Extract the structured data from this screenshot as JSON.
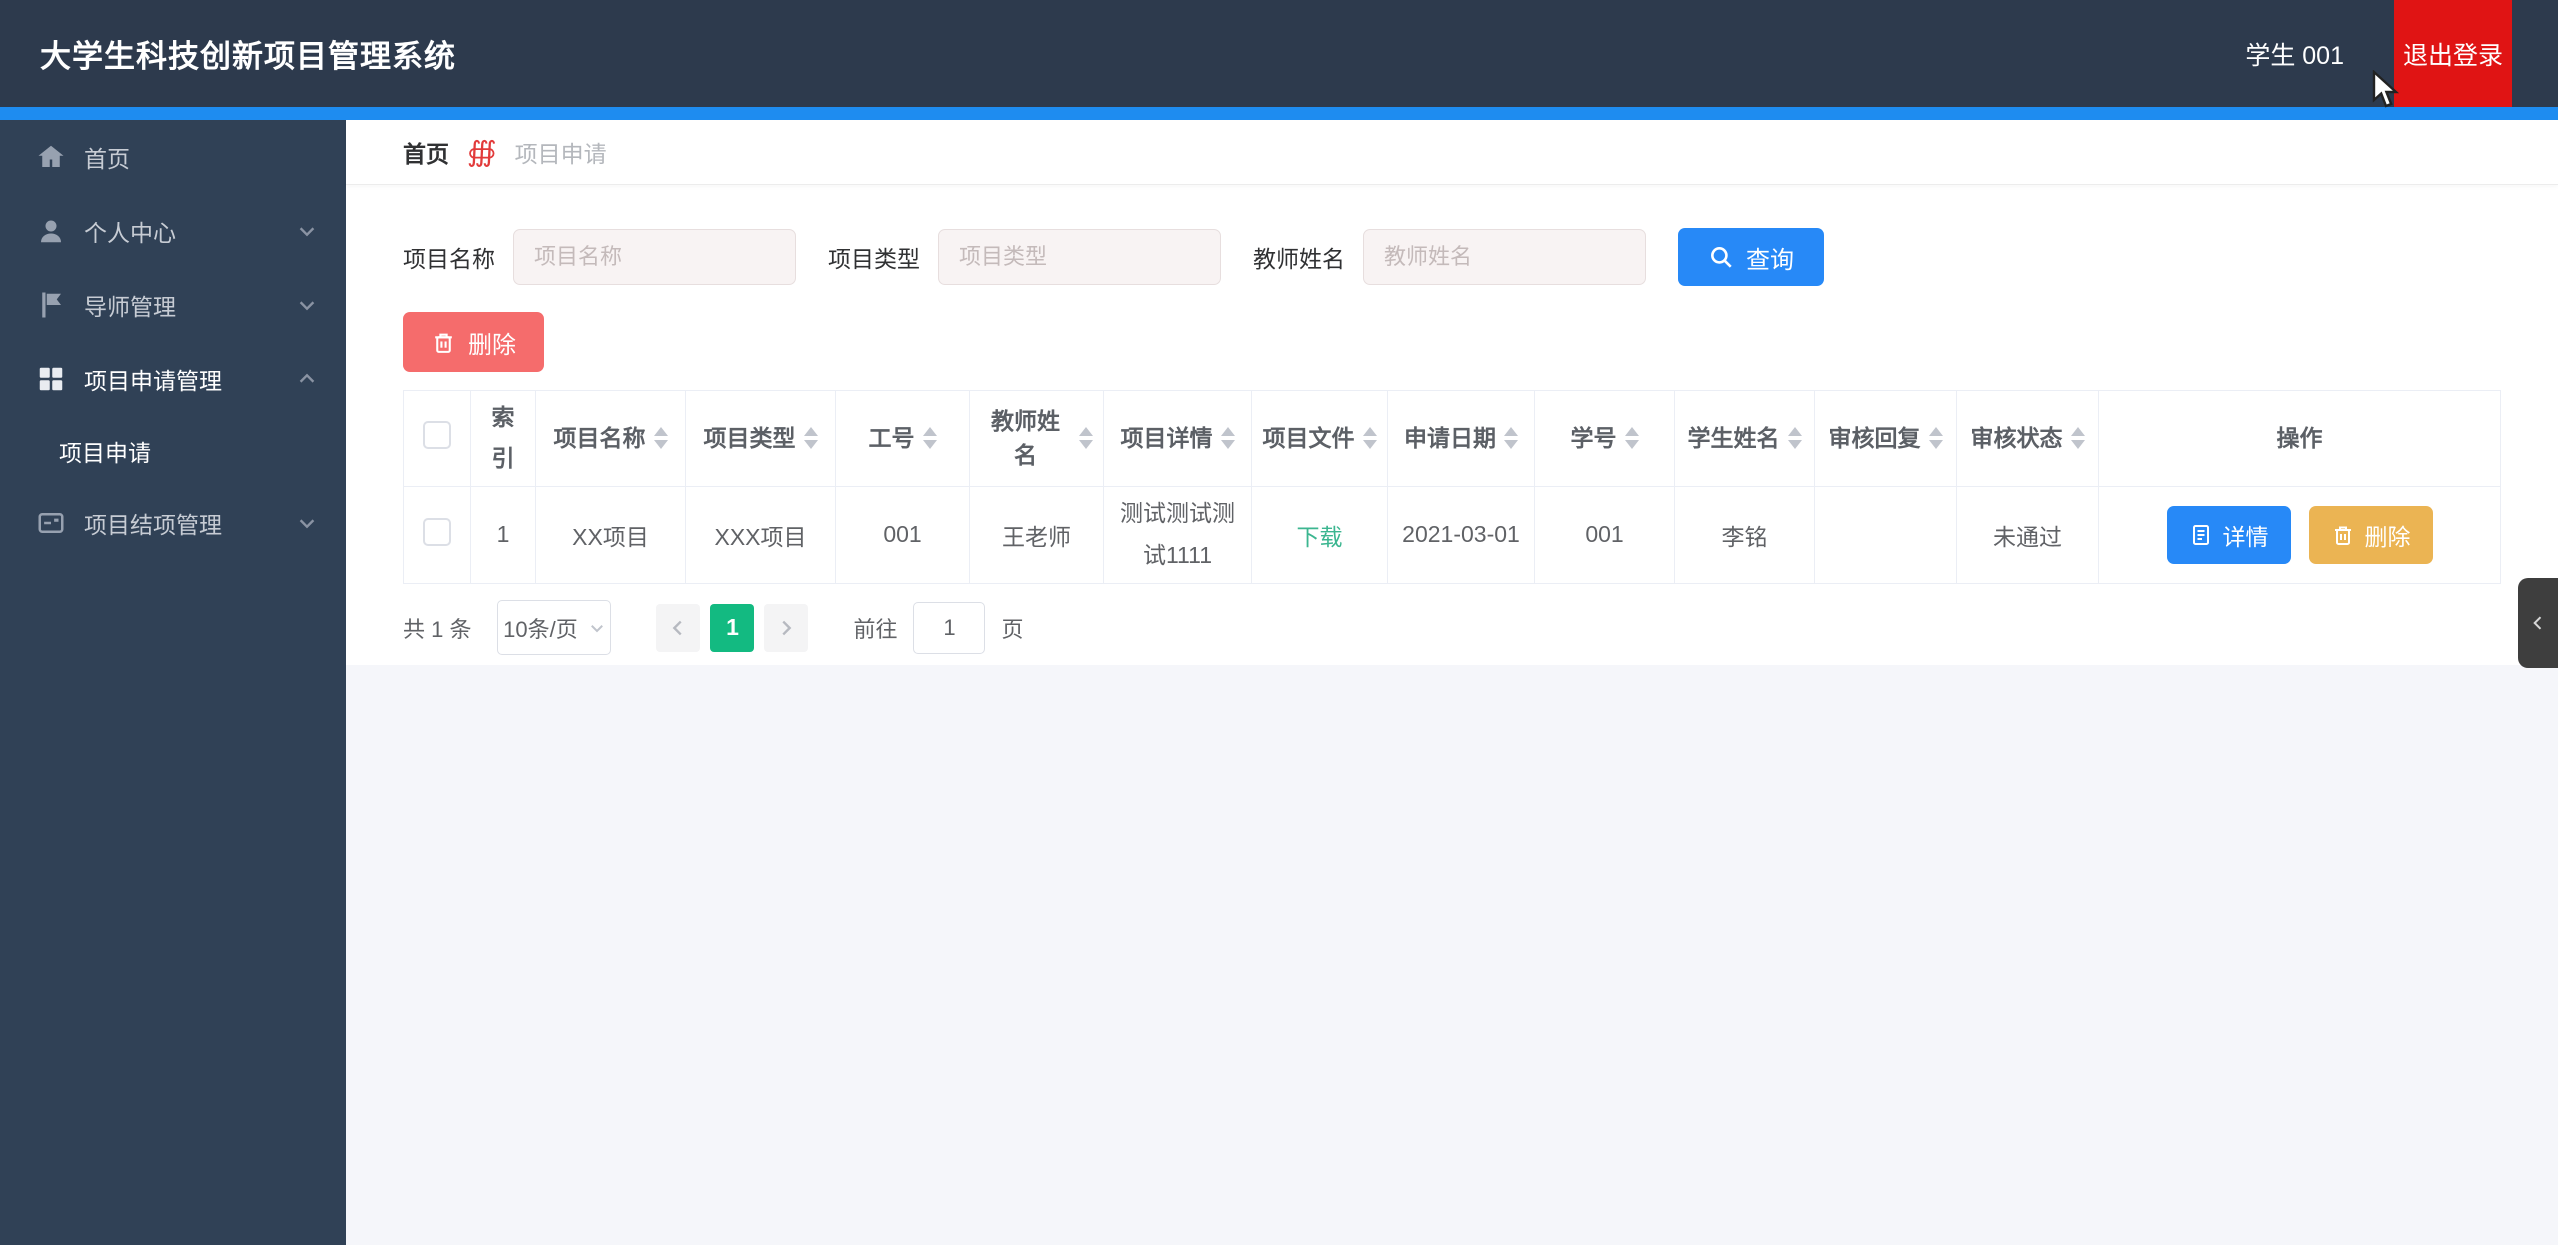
{
  "header": {
    "title": "大学生科技创新项目管理系统",
    "user": "学生 001",
    "logout_label": "退出登录"
  },
  "sidebar": {
    "items": [
      {
        "label": "首页",
        "icon": "home-icon"
      },
      {
        "label": "个人中心",
        "icon": "user-icon"
      },
      {
        "label": "导师管理",
        "icon": "flag-icon"
      },
      {
        "label": "项目申请管理",
        "icon": "grid-icon"
      },
      {
        "label": "项目结项管理",
        "icon": "card-icon"
      }
    ],
    "submenu": {
      "label": "项目申请"
    }
  },
  "breadcrumb": {
    "home": "首页",
    "separator": "∰",
    "current": "项目申请"
  },
  "filters": {
    "fields": [
      {
        "label": "项目名称",
        "placeholder": "项目名称"
      },
      {
        "label": "项目类型",
        "placeholder": "项目类型"
      },
      {
        "label": "教师姓名",
        "placeholder": "教师姓名"
      }
    ],
    "search_label": "查询",
    "delete_label": "删除"
  },
  "table": {
    "columns": [
      {
        "label": "索引"
      },
      {
        "label": "项目名称"
      },
      {
        "label": "项目类型"
      },
      {
        "label": "工号"
      },
      {
        "label": "教师姓名"
      },
      {
        "label": "项目详情"
      },
      {
        "label": "项目文件"
      },
      {
        "label": "申请日期"
      },
      {
        "label": "学号"
      },
      {
        "label": "学生姓名"
      },
      {
        "label": "审核回复"
      },
      {
        "label": "审核状态"
      },
      {
        "label": "操作"
      }
    ],
    "rows": [
      {
        "index": "1",
        "project_name": "XX项目",
        "project_type": "XXX项目",
        "job_no": "001",
        "teacher_name": "王老师",
        "detail": "测试测试测试1111",
        "file_link": "下载",
        "apply_date": "2021-03-01",
        "student_no": "001",
        "student_name": "李铭",
        "review_reply": "",
        "review_status": "未通过"
      }
    ],
    "row_actions": {
      "detail": "详情",
      "delete": "删除"
    }
  },
  "pagination": {
    "total": "共 1 条",
    "page_size": "10条/页",
    "current_page": "1",
    "goto_label": "前往",
    "goto_value": "1",
    "page_unit": "页"
  },
  "colors": {
    "header_bg": "#2d3a4d",
    "sidebar_bg": "#304156",
    "accent_strip": "#1e8cf0",
    "logout_red": "#e01414",
    "primary_blue": "#2789f7",
    "danger_red": "#f56c6c",
    "warning_yellow": "#ebb453",
    "success_green": "#13ba81",
    "link_green": "#3cb690"
  }
}
